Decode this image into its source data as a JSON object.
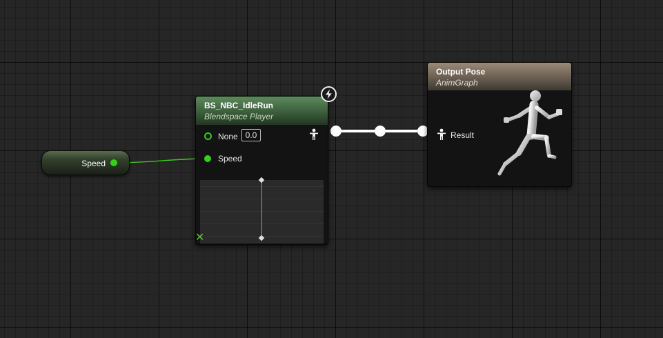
{
  "graph": {
    "variable_node": {
      "label": "Speed"
    },
    "blendspace_node": {
      "title": "BS_NBC_IdleRun",
      "subtitle": "Blendspace Player",
      "pins": {
        "none_label": "None",
        "none_value": "0.0",
        "speed_label": "Speed"
      },
      "badge_icon": "lightning-icon",
      "corner_icon": "x-icon"
    },
    "output_node": {
      "title": "Output Pose",
      "subtitle": "AnimGraph",
      "result_label": "Result",
      "preview_icon": "mannequin-running-icon"
    }
  },
  "colors": {
    "canvas_background": "#262626",
    "float_pin": "#35d018",
    "pose_wire": "#ffffff",
    "blendspace_header": "#4d754d",
    "output_header": "#8a7b6a"
  }
}
